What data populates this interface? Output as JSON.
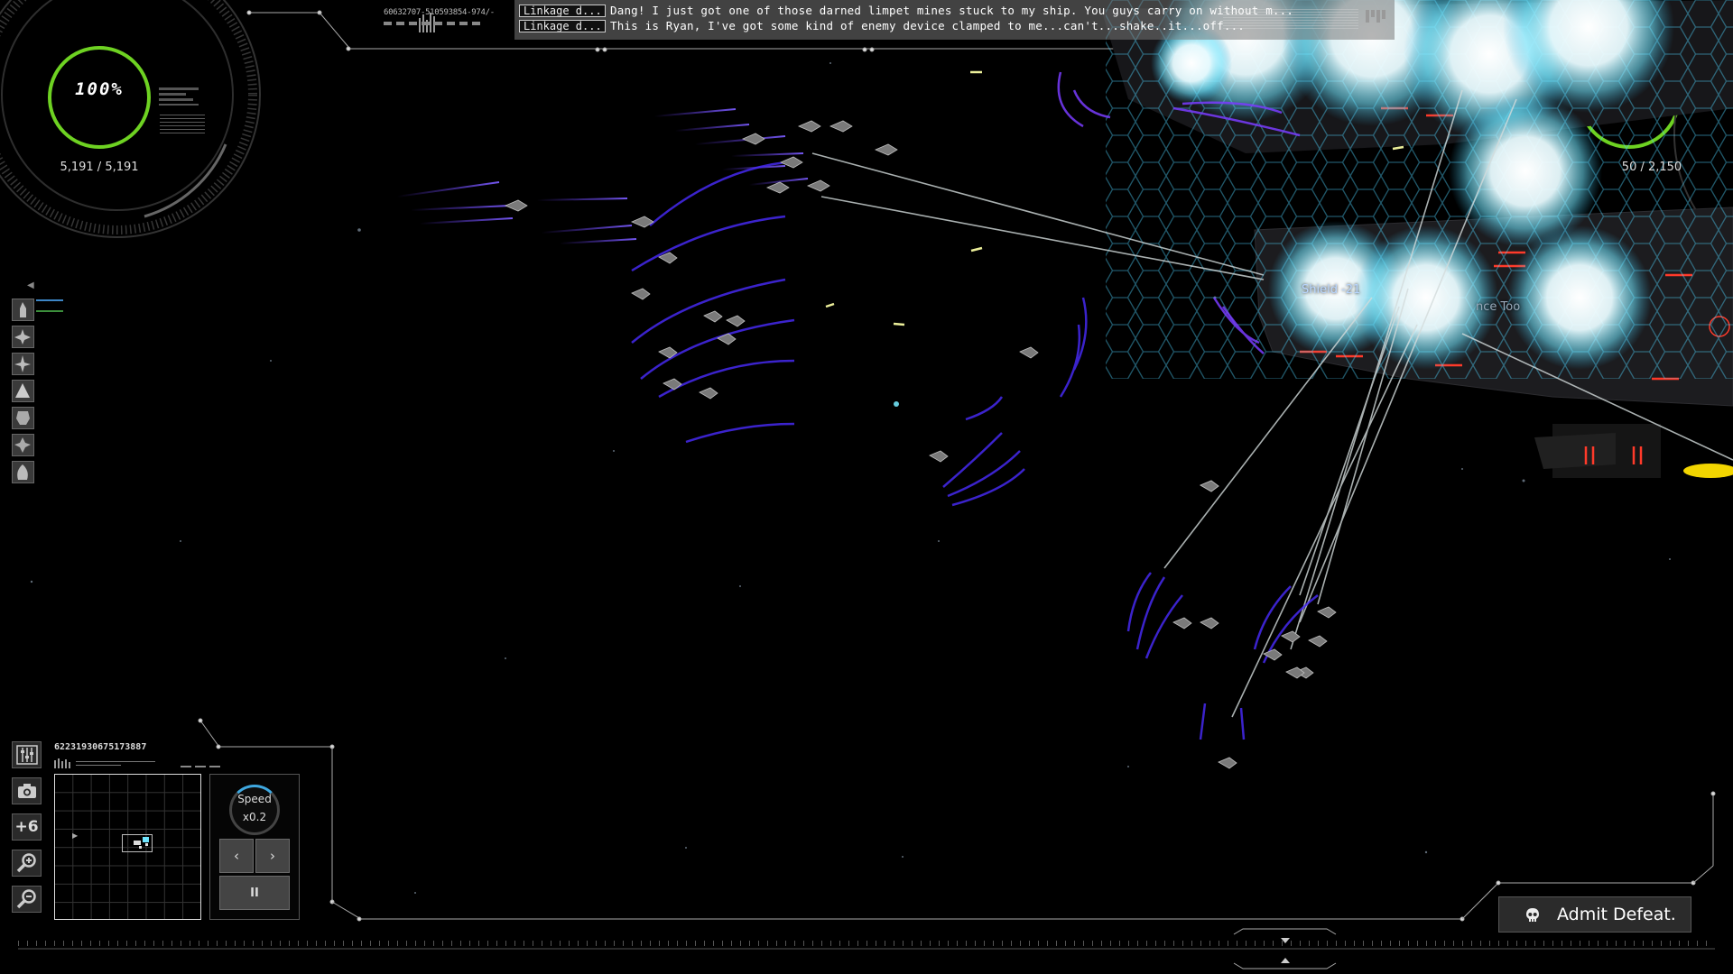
{
  "comms": {
    "code": "60632707-510593854-974/-",
    "messages": [
      {
        "sender": "Linkage d...",
        "text": "Dang! I just got one of those darned limpet mines stuck to my ship. You guys carry on without m..."
      },
      {
        "sender": "Linkage d...",
        "text": "This is Ryan, I've got some kind of enemy device clamped to me...can't...shake..it...off..."
      }
    ]
  },
  "player_status": {
    "hull_percent": "100%",
    "hull_value": "5,191 / 5,191"
  },
  "enemy_status": {
    "hull_value": "50 / 2,150"
  },
  "floating_labels": {
    "shield": "Shield -21",
    "partial": "nce Too"
  },
  "minimap": {
    "code": "62231930675173887"
  },
  "speed": {
    "label": "Speed",
    "value": "x0.2",
    "prev": "‹",
    "next": "›",
    "pause": "II"
  },
  "tools": {
    "plus": "+6"
  },
  "actions": {
    "admit_defeat": "Admit Defeat."
  },
  "colors": {
    "ring_green": "#6ed222",
    "shield_cyan": "#6fe6ff",
    "trail_purple": "#6a3cff",
    "laser": "#cfd8d8"
  },
  "icons": [
    "settings-sliders-icon",
    "camera-icon",
    "zoom-in-icon",
    "zoom-out-icon",
    "skull-icon",
    "chevron-left-icon",
    "chevron-right-icon",
    "pause-icon"
  ]
}
